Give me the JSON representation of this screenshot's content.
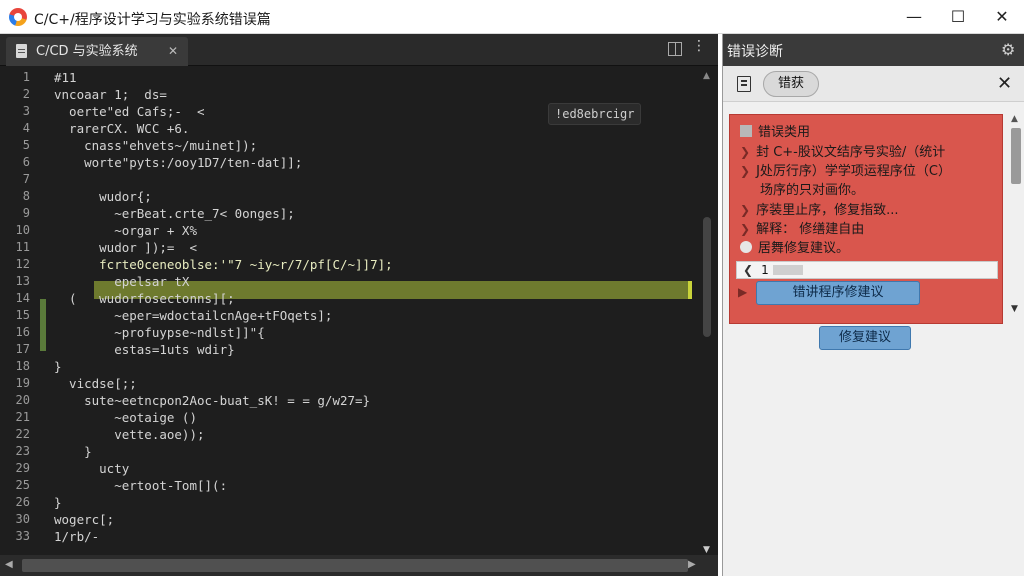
{
  "window": {
    "title": "C/C+/程序设计学习与实验系统错误篇",
    "minimize_icon": "minimize-icon",
    "maximize_icon": "maximize-icon",
    "close_icon": "close-icon"
  },
  "editor": {
    "tab_label": "C/CD 与实验系统",
    "hover_badge": "!ed8ebrcigr",
    "line_numbers": [
      "1",
      "2",
      "3",
      "4",
      "5",
      "6",
      "7",
      "8",
      "9",
      "10",
      "11",
      "12",
      "13",
      "14",
      "15",
      "16",
      "17",
      "18",
      "19",
      "20",
      "21",
      "22",
      "23",
      "29",
      "25",
      "26",
      "30",
      "33"
    ],
    "lines": [
      "#11",
      "vncoaar 1;  ds=",
      "  oerte\"ed Cafs;-  <",
      "  rarerCX. WCC +6.",
      "    cnass\"ehvets~/muinet]);",
      "    worte\"pyts:/ooy1D7/ten-dat]];",
      "",
      "      wudor{;",
      "        ~erBeat.crte_7< 0onges];",
      "        ~orgar + X%",
      "      wudor ]);=  <",
      "      fcrte0ceneoblse:'\"7 ~iy~r/7/pf[C/~]]7];",
      "        epelsar tX",
      "  (   wudorfosectonns][;",
      "        ~eper=wdoctailcnAge+tFOqets];",
      "        ~profuypse~ndlst]]\"{",
      "        estas=1uts wdir}",
      "}",
      "  vicdse[;;",
      "    sute~eetncpon2Aoc-buat_sK! = = g/w27=}",
      "        ~eotaige ()",
      "        vette.aoe));",
      "    }",
      "      ucty",
      "        ~ertoot-Tom[](:",
      "}",
      "wogerc[;",
      "1/rb/-"
    ]
  },
  "diagnostics": {
    "title": "错误诊断",
    "tab_label": "错获",
    "items": [
      "错误类用",
      "封 C+-股议文结序号实验/（统计",
      "J处厉行序）学学项运程序位（C）",
      "场序的只对画你。",
      "序装里止序，修复指致...",
      "解释： 修缮建自由",
      "居舞修复建议。"
    ],
    "input_value": "1",
    "inner_button": "错讲程序修建议",
    "outer_button": "修复建议"
  },
  "colors": {
    "accent_red": "#d9564d",
    "button_blue": "#6fa3d2",
    "editor_bg": "#1e1e1e",
    "highlight": "#6e7a2e"
  }
}
